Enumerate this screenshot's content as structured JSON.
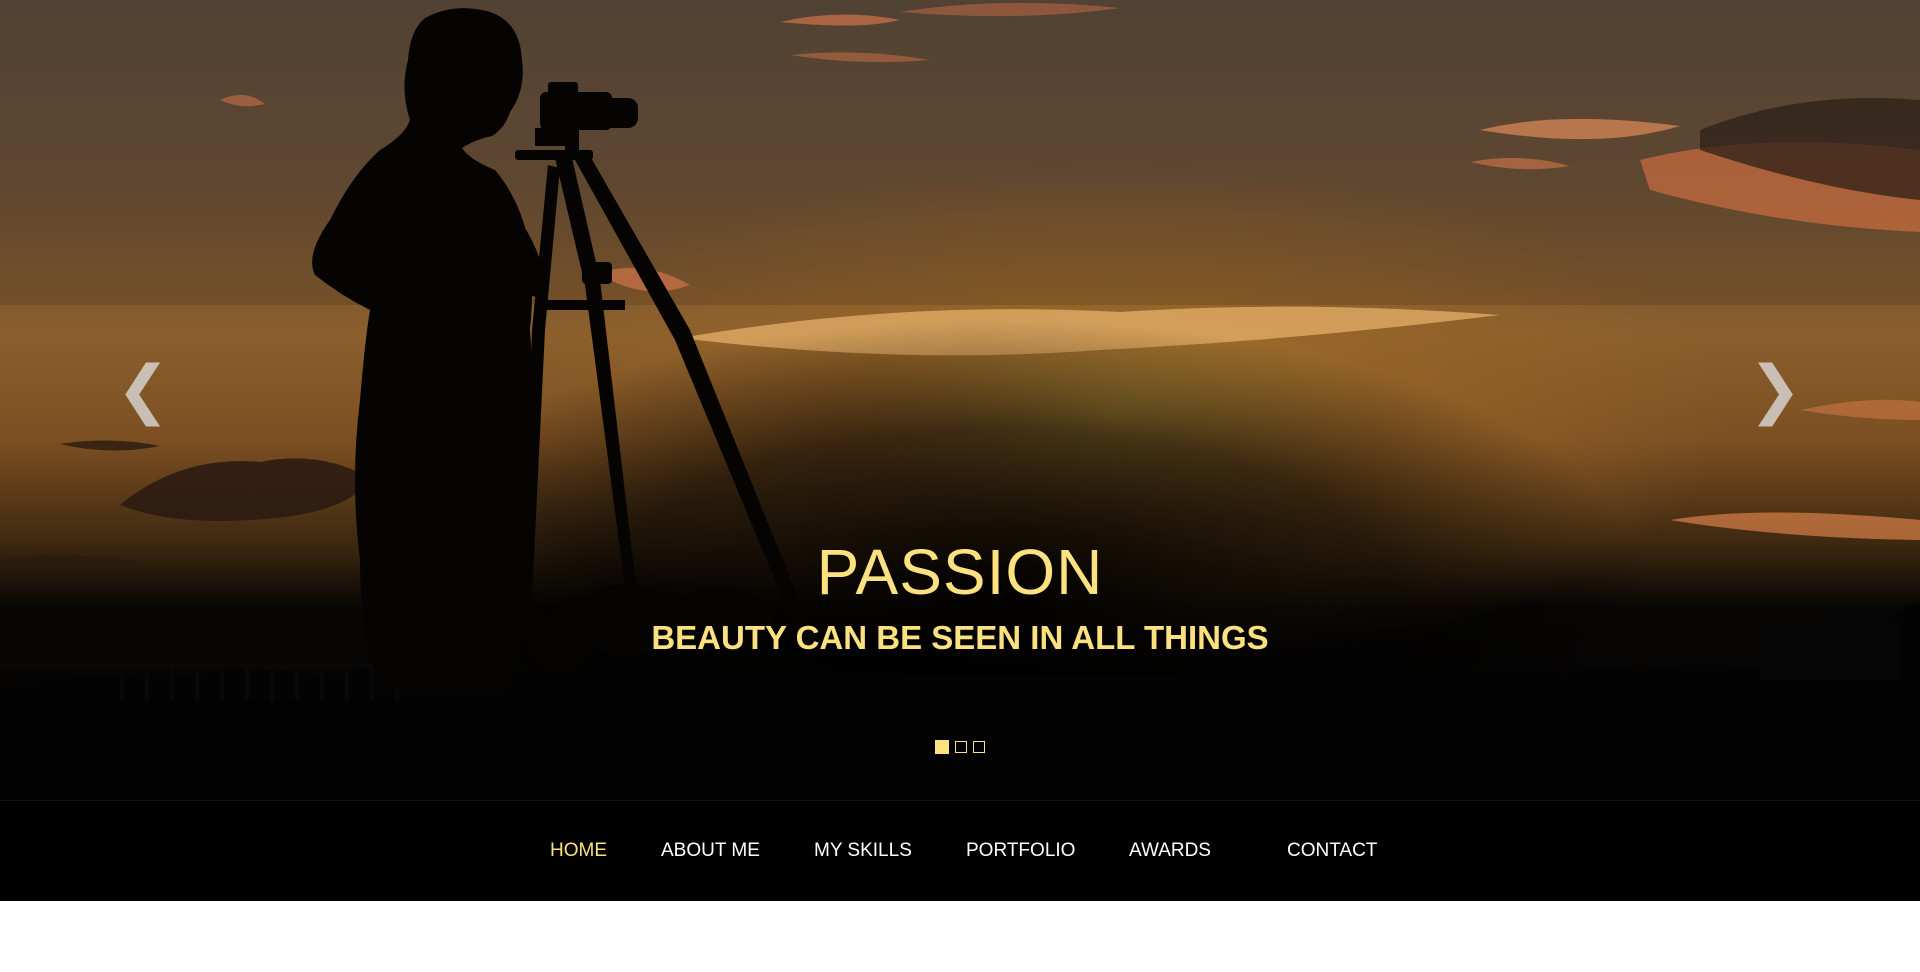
{
  "hero": {
    "prev_icon": "chevron-left-icon",
    "prev_glyph": "❮",
    "next_icon": "chevron-right-icon",
    "next_glyph": "❯",
    "title": "PASSION",
    "subtitle": "BEAUTY CAN BE SEEN IN ALL THINGS",
    "slide_count": 3,
    "active_slide": 1
  },
  "nav": {
    "items": [
      {
        "label": "HOME",
        "active": true
      },
      {
        "label": "ABOUT ME",
        "active": false
      },
      {
        "label": "MY SKILLS",
        "active": false
      },
      {
        "label": "PORTFOLIO",
        "active": false
      },
      {
        "label": "AWARDS",
        "active": false
      },
      {
        "label": "CONTACT",
        "active": false
      }
    ]
  },
  "colors": {
    "accent": "#fbe17f",
    "nav_background": "#000000",
    "nav_text": "#ffffff"
  }
}
